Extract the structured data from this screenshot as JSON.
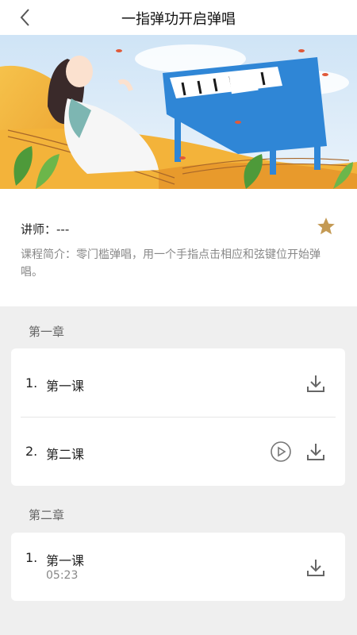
{
  "header": {
    "title": "一指弹功开启弹唱",
    "back_icon": "chevron-left-icon"
  },
  "course": {
    "teacher": "讲师：---",
    "intro": "课程简介：零门槛弹唱，用一个手指点击相应和弦键位开始弹唱。",
    "favorite_icon": "star-icon",
    "favorite_color": "#c49a54"
  },
  "chapters": [
    {
      "title": "第一章",
      "lessons": [
        {
          "num": "1.",
          "name": "第一课"
        },
        {
          "num": "2.",
          "name": "第二课"
        }
      ]
    },
    {
      "title": "第二章",
      "lessons": [
        {
          "num": "1.",
          "name": "第一课",
          "duration": "05:23"
        }
      ]
    }
  ]
}
